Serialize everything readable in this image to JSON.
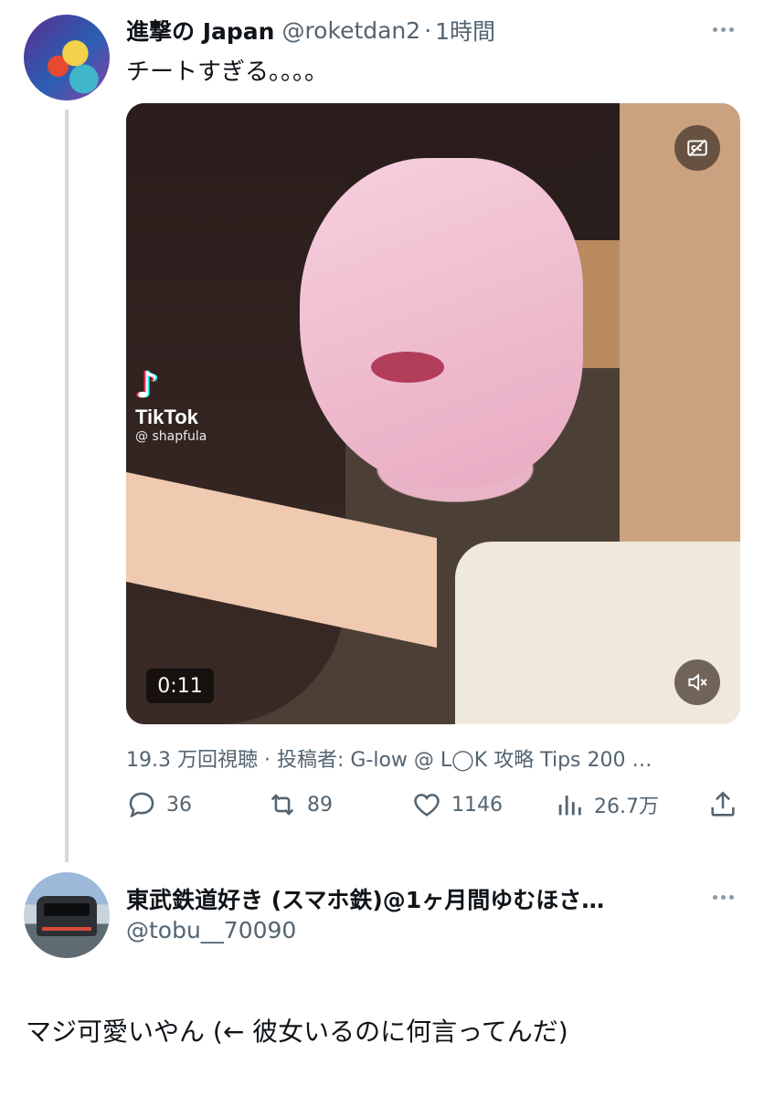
{
  "tweet": {
    "author_name": "進撃の Japan",
    "handle": "@roketdan2",
    "separator": "·",
    "time": "1時間",
    "text": "チートすぎる。。。。",
    "media": {
      "watermark_brand": "TikTok",
      "watermark_user": "@ shapfula",
      "duration": "0:11",
      "captions_icon": "captions-off-icon",
      "mute_icon": "volume-muted-icon"
    },
    "attribution": "19.3 万回視聴 · 投稿者: G-low @ L◯K 攻略 Tips 200 …",
    "actions": {
      "replies": "36",
      "retweets": "89",
      "likes": "1146",
      "views": "26.7万"
    }
  },
  "reply": {
    "author_name": "東武鉄道好き (スマホ鉄)@1ヶ月間ゆむほさ…",
    "handle": "@tobu__70090",
    "text": "マジ可愛いやん (← 彼女いるのに何言ってんだ)"
  },
  "colors": {
    "secondary_text": "#536471",
    "thread_line": "#cfd9de"
  }
}
